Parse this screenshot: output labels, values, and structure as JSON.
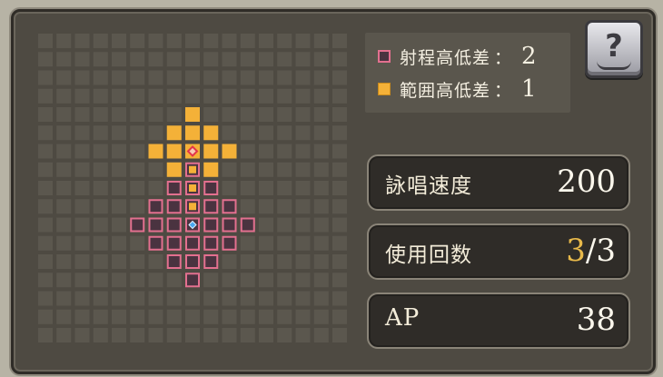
{
  "help_button": {
    "label": "?"
  },
  "legend": {
    "range": {
      "label": "射程高低差",
      "sep": "：",
      "value": "2"
    },
    "area": {
      "label": "範囲高低差",
      "sep": "：",
      "value": "1"
    }
  },
  "stats": {
    "cast_speed": {
      "label": "詠唱速度",
      "value": "200"
    },
    "uses": {
      "label": "使用回数",
      "current": "3",
      "sep": "/",
      "max": "3"
    },
    "ap": {
      "label": "AP",
      "value": "38"
    }
  },
  "colors": {
    "range": "#e3708f",
    "area": "#f4b138",
    "caster": "#4aa7f0",
    "target": "#e2354a",
    "empty_cell": "#5b574e"
  },
  "grid": {
    "cols": 17,
    "rows": 17,
    "range_cells": [
      [
        8,
        7
      ],
      [
        7,
        8
      ],
      [
        8,
        8
      ],
      [
        9,
        8
      ],
      [
        6,
        9
      ],
      [
        7,
        9
      ],
      [
        8,
        9
      ],
      [
        9,
        9
      ],
      [
        10,
        9
      ],
      [
        5,
        10
      ],
      [
        6,
        10
      ],
      [
        7,
        10
      ],
      [
        8,
        10
      ],
      [
        9,
        10
      ],
      [
        10,
        10
      ],
      [
        11,
        10
      ],
      [
        6,
        11
      ],
      [
        7,
        11
      ],
      [
        8,
        11
      ],
      [
        9,
        11
      ],
      [
        10,
        11
      ],
      [
        7,
        12
      ],
      [
        8,
        12
      ],
      [
        9,
        12
      ],
      [
        8,
        13
      ]
    ],
    "area_cells": [
      [
        8,
        4
      ],
      [
        7,
        5
      ],
      [
        8,
        5
      ],
      [
        9,
        5
      ],
      [
        6,
        6
      ],
      [
        7,
        6
      ],
      [
        8,
        6
      ],
      [
        9,
        6
      ],
      [
        10,
        6
      ],
      [
        7,
        7
      ],
      [
        8,
        7
      ],
      [
        9,
        7
      ],
      [
        8,
        8
      ],
      [
        8,
        9
      ]
    ],
    "caster": [
      8,
      10
    ],
    "target": [
      8,
      6
    ]
  }
}
